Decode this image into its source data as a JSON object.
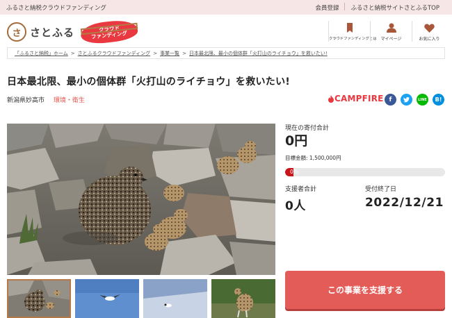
{
  "topbar": {
    "left": "ふるさと納税クラウドファンディング",
    "links": [
      "会員登録",
      "ふるさと納税サイトさとふるTOP"
    ]
  },
  "header": {
    "logo_text": "さとふる",
    "badge_line1": "クラウド",
    "badge_line2": "ファンディング",
    "nav": [
      {
        "icon": "bookmark-icon",
        "label": "クラウドファンディングとは"
      },
      {
        "icon": "user-icon",
        "label": "マイページ"
      },
      {
        "icon": "heart-icon",
        "label": "お気に入り"
      }
    ]
  },
  "breadcrumb": [
    "「ふるさと納税」ホーム",
    "さとふるクラウドファンディング",
    "事業一覧",
    "日本最北限、最小の個体群「火打山のライチョウ」を救いたい!"
  ],
  "project": {
    "title": "日本最北限、最小の個体群「火打山のライチョウ」を救いたい!",
    "location": "新潟県妙高市",
    "category": "環境・衛生",
    "platform": "CAMPFIRE"
  },
  "funding": {
    "current_label": "現在の寄付合計",
    "current_amount": "0円",
    "goal_text": "目標金額: 1,500,000円",
    "progress_text": "0%",
    "progress_fraction": 0.0,
    "supporters_label": "支援者合計",
    "supporters_value": "0人",
    "deadline_label": "受付終了日",
    "deadline_value": "2022/12/21",
    "support_button": "この事業を支援する"
  },
  "colors": {
    "accent": "#e35c58",
    "topbar_bg": "#f6e6e5",
    "campfire": "#e9383f",
    "progress": "#c7151b"
  }
}
